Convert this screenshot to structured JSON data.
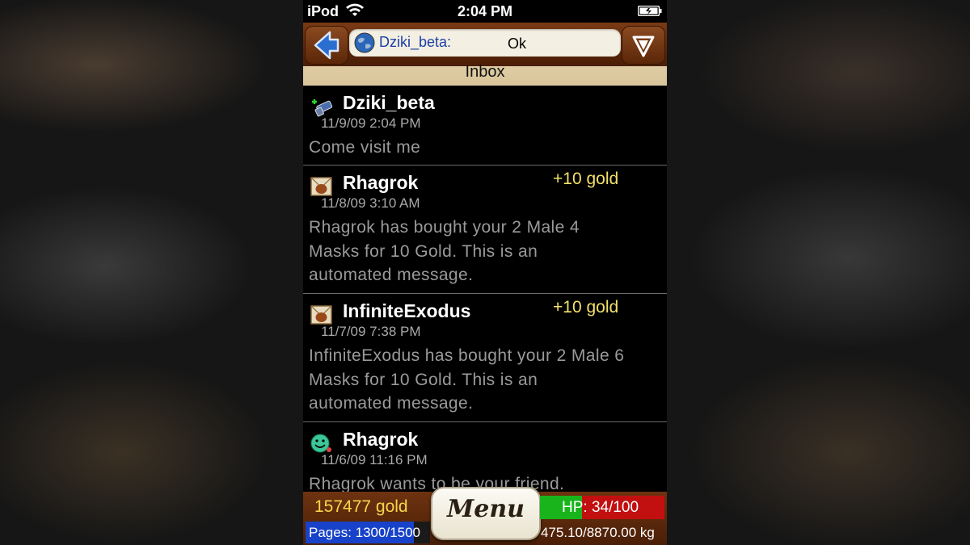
{
  "status_bar": {
    "carrier": "iPod",
    "time": "2:04 PM"
  },
  "header": {
    "chat": {
      "sender": "Dziki_beta:",
      "text": "Ok"
    },
    "title": "Inbox",
    "back_icon": "arrow-left-icon",
    "down_icon": "arrow-down-icon"
  },
  "messages": [
    {
      "icon": "add-friend-icon",
      "sender": "Dziki_beta",
      "date": "11/9/09 2:04 PM",
      "reward": "",
      "body": "Come visit me"
    },
    {
      "icon": "sale-mail-icon",
      "sender": "Rhagrok",
      "date": "11/8/09 3:10 AM",
      "reward": "+10 gold",
      "body_lines": [
        "Rhagrok has bought your 2 Male 4",
        "Masks for 10 Gold.  This is an",
        "automated message."
      ]
    },
    {
      "icon": "sale-mail-icon",
      "sender": "InfiniteExodus",
      "date": "11/7/09 7:38 PM",
      "reward": "+10 gold",
      "body_lines": [
        "InfiniteExodus has bought your 2 Male 6",
        "Masks for 10 Gold.  This is an",
        "automated message."
      ]
    },
    {
      "icon": "friend-request-icon",
      "sender": "Rhagrok",
      "date": "11/6/09 11:16 PM",
      "reward": "",
      "body": "Rhagrok wants to be your friend."
    }
  ],
  "bottom_bar": {
    "gold": "157477 gold",
    "pages": "Pages: 1300/1500",
    "pages_fraction": 0.867,
    "menu_label": "Menu",
    "hp": "HP: 34/100",
    "hp_fraction": 0.34,
    "weight": "475.10/8870.00 kg"
  },
  "colors": {
    "reward": "#f2e06a",
    "gold": "#f5d64a",
    "chat_sender": "#1d3fa5",
    "hp_green": "#19b41c",
    "hp_red": "#c21010",
    "pages_blue": "#1742c9"
  }
}
